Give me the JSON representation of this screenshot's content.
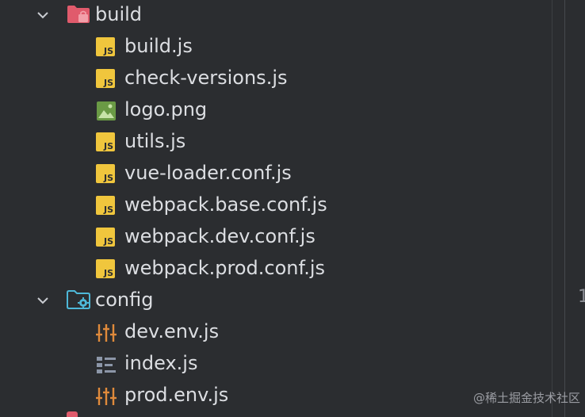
{
  "tree": {
    "build_folder": {
      "label": "build",
      "expanded": true,
      "icon": "folder-icon"
    },
    "build_files": [
      {
        "label": "build.js",
        "icon": "js-file-icon"
      },
      {
        "label": "check-versions.js",
        "icon": "js-file-icon"
      },
      {
        "label": "logo.png",
        "icon": "image-file-icon"
      },
      {
        "label": "utils.js",
        "icon": "js-file-icon"
      },
      {
        "label": "vue-loader.conf.js",
        "icon": "js-file-icon"
      },
      {
        "label": "webpack.base.conf.js",
        "icon": "js-file-icon"
      },
      {
        "label": "webpack.dev.conf.js",
        "icon": "js-file-icon"
      },
      {
        "label": "webpack.prod.conf.js",
        "icon": "js-file-icon"
      }
    ],
    "config_folder": {
      "label": "config",
      "expanded": true,
      "icon": "config-folder-icon"
    },
    "config_files": [
      {
        "label": "dev.env.js",
        "icon": "settings-file-icon"
      },
      {
        "label": "index.js",
        "icon": "list-file-icon"
      },
      {
        "label": "prod.env.js",
        "icon": "settings-file-icon"
      }
    ]
  },
  "icons": {
    "js_badge_text": "JS"
  },
  "gutter": {
    "line_fragment": "1"
  },
  "watermark": "@稀土掘金技术社区",
  "colors": {
    "background": "#2b2d30",
    "js_badge": "#f0c63d",
    "build_folder": "#e05b6c",
    "config_folder": "#4eb8d8",
    "image_icon": "#6a9a45",
    "settings_icon": "#e08a3b",
    "list_icon": "#8c96a8"
  }
}
